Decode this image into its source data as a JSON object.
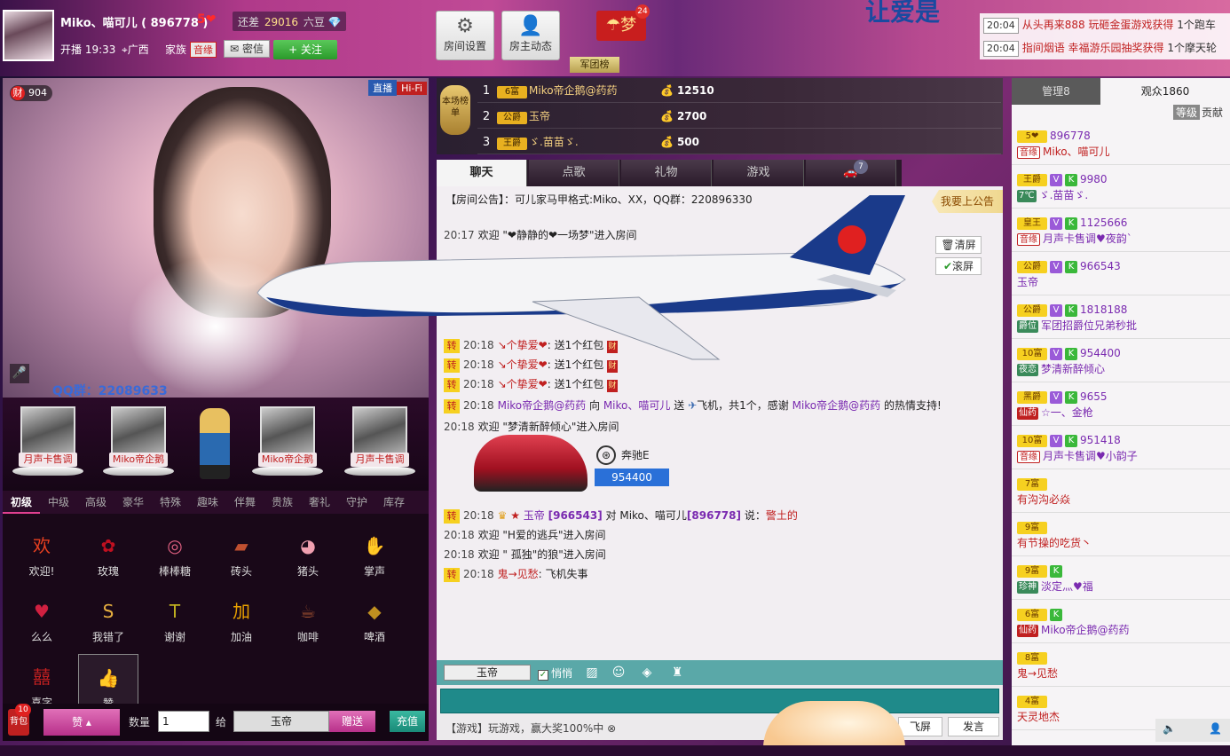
{
  "header": {
    "anchor_name": "Miko、喵可儿 ( 896778 )",
    "anchor_level": "5",
    "level_gap_label": "还差",
    "level_gap_value": "29016",
    "level_gap_unit": "六豆",
    "live_label": "开播",
    "live_time": "19:33",
    "location": "广西",
    "family_label": "家族",
    "family_badge": "音缘",
    "message_label": "密信",
    "follow_label": "+ 关注",
    "tool_settings": "房间设置",
    "tool_owner": "房主动态",
    "dream_label": "梦",
    "dream_count": "24",
    "army_label": "军团榜",
    "banner_text": "让爱是"
  },
  "ticker": [
    {
      "time": "20:04",
      "text": "从头再来888 玩砸金蛋游戏获得",
      "tail": "1个跑车"
    },
    {
      "time": "20:04",
      "text": "指间烟语 幸福游乐园抽奖获得",
      "tail": "1个摩天轮"
    }
  ],
  "video": {
    "money_icon": "财",
    "money_value": "904",
    "tag_live": "直播",
    "tag_hifi": "Hi-Fi",
    "qq_overlay": "QQ群：22089633"
  },
  "mic_seats": [
    "月声卡售调",
    "Miko帝企鹅",
    "Miko帝企鹅",
    "月声卡售调"
  ],
  "gift_tabs": [
    "初级",
    "中级",
    "高级",
    "豪华",
    "特殊",
    "趣味",
    "伴舞",
    "贵族",
    "奢礼",
    "守护",
    "库存"
  ],
  "gifts": [
    {
      "name": "欢迎!",
      "icon": "欢",
      "color": "#e84020"
    },
    {
      "name": "玫瑰",
      "icon": "✿",
      "color": "#c01020"
    },
    {
      "name": "棒棒糖",
      "icon": "◎",
      "color": "#e06080"
    },
    {
      "name": "砖头",
      "icon": "▰",
      "color": "#c05030"
    },
    {
      "name": "猪头",
      "icon": "◕",
      "color": "#f0a0b0"
    },
    {
      "name": "掌声",
      "icon": "✋",
      "color": "#e8a020"
    },
    {
      "name": "么么",
      "icon": "♥",
      "color": "#d02040"
    },
    {
      "name": "我错了",
      "icon": "S",
      "color": "#e8b040"
    },
    {
      "name": "谢谢",
      "icon": "T",
      "color": "#c0b020"
    },
    {
      "name": "加油",
      "icon": "加",
      "color": "#e8a000"
    },
    {
      "name": "咖啡",
      "icon": "☕",
      "color": "#a05030"
    },
    {
      "name": "啤酒",
      "icon": "◆",
      "color": "#c09020"
    },
    {
      "name": "喜字",
      "icon": "囍",
      "color": "#c02020"
    },
    {
      "name": "赞",
      "icon": "👍",
      "color": "#e0a030"
    }
  ],
  "send_bar": {
    "bag_label": "背包",
    "bag_count": "10",
    "gift_pick": "赞",
    "qty_label": "数量",
    "qty_value": "1",
    "give_label": "给",
    "target": "玉帝",
    "send_label": "赠送",
    "recharge": "充值"
  },
  "rank": {
    "stamp": "本场榜单",
    "rows": [
      {
        "rank": "1",
        "badge": "6富",
        "name": "Miko帝企鹅@药药",
        "value": "12510"
      },
      {
        "rank": "2",
        "badge": "公爵",
        "name": "玉帝",
        "value": "2700"
      },
      {
        "rank": "3",
        "badge": "王爵",
        "name": "ゞ.苗苗ゞ.",
        "value": "500"
      }
    ]
  },
  "chat_tabs": [
    "聊天",
    "点歌",
    "礼物",
    "游戏",
    ""
  ],
  "chat_tab_badge": "7",
  "chat": {
    "announce": "【房间公告】：可儿家马甲格式:Miko、XX，QQ群：220896330",
    "post_announce": "我要上公告",
    "clear": "清屏",
    "scroll": "滚屏",
    "msgs": [
      {
        "time": "20:17",
        "text": "欢迎 \"❤静静的❤一场梦\"进入房间"
      },
      {
        "time": "20:18",
        "user": "↘个挚爱❤",
        "text": ": 送1个红包"
      },
      {
        "time": "20:18",
        "user": "↘个挚爱❤",
        "text": ": 送1个红包"
      },
      {
        "time": "20:18",
        "user": "↘个挚爱❤",
        "text": ": 送1个红包"
      },
      {
        "time": "20:18",
        "user": "Miko帝企鹅@药药",
        "text": "向",
        "target": "Miko、喵可儿",
        "text2": "送",
        "text3": "飞机，共1个，感谢",
        "user2": "Miko帝企鹅@药药",
        "text4": "的热情支持!"
      },
      {
        "time": "20:18",
        "text": "欢迎 \"梦清新醉倾心\"进入房间"
      },
      {
        "time": "20:18",
        "user": "玉帝",
        "uid": "[966543]",
        "text": "对 Miko、喵可儿",
        "uid2": "[896778]",
        "text2": "说：",
        "content": "警土的"
      },
      {
        "time": "20:18",
        "text": "欢迎 \"H爱的逃兵\"进入房间"
      },
      {
        "time": "20:18",
        "text": "欢迎 \" 孤独\"的狼\"进入房间"
      },
      {
        "time": "20:18",
        "user": "鬼→见愁",
        "text": ": 飞机失事"
      }
    ],
    "car_name": "奔驰E",
    "car_id": "954400",
    "zhuan": "转",
    "redpack": "财"
  },
  "chat_toolbar": {
    "target": "玉帝",
    "whisper": "悄悄",
    "input_placeholder": "",
    "game_tip": "【游戏】玩游戏，赢大奖100%中",
    "fly": "飞屏",
    "speak": "发言"
  },
  "audience": {
    "tab_admin": "管理8",
    "tab_audience": "观众1860",
    "sub_level": "等级",
    "sub_contrib": "贡献",
    "rows": [
      {
        "rich": "5❤",
        "v": false,
        "k": false,
        "uid": "896778",
        "fam": "音缘",
        "name": "Miko、喵可儿",
        "red": true
      },
      {
        "rich": "王爵",
        "v": true,
        "k": true,
        "uid": "9980",
        "fam": "7℃",
        "name": "ゞ.苗苗ゞ.",
        "red": false
      },
      {
        "rich": "皇王",
        "v": true,
        "k": true,
        "uid": "1125666",
        "fam": "音缘",
        "name": "月声卡售调♥夜韵`",
        "red": false
      },
      {
        "rich": "公爵",
        "v": true,
        "k": true,
        "uid": "966543",
        "fam": "",
        "name": "玉帝",
        "red": false
      },
      {
        "rich": "公爵",
        "v": true,
        "k": true,
        "uid": "1818188",
        "fam": "爵位",
        "name": "军团招爵位兄弟秒批",
        "red": false
      },
      {
        "rich": "10富",
        "v": true,
        "k": true,
        "uid": "954400",
        "fam": "夜恋",
        "name": "梦清新醉倾心",
        "red": false
      },
      {
        "rich": "黑爵",
        "v": true,
        "k": true,
        "uid": "9655",
        "fam": "仙药",
        "name": "☆一、金枪",
        "red": false
      },
      {
        "rich": "10富",
        "v": true,
        "k": true,
        "uid": "951418",
        "fam": "音缘",
        "name": "月声卡售调♥小韵子",
        "red": false
      },
      {
        "rich": "7富",
        "v": false,
        "k": false,
        "uid": "",
        "fam": "",
        "name": "有沟沟必焱",
        "red": true
      },
      {
        "rich": "9富",
        "v": false,
        "k": false,
        "uid": "",
        "fam": "",
        "name": "有节操的吃货丶",
        "red": true
      },
      {
        "rich": "9富",
        "v": false,
        "k": true,
        "uid": "",
        "fam": "珍神",
        "name": "淡定灬♥福",
        "red": false
      },
      {
        "rich": "6富",
        "v": false,
        "k": true,
        "uid": "",
        "fam": "仙药",
        "name": "Miko帝企鹅@药药",
        "red": false
      },
      {
        "rich": "8富",
        "v": false,
        "k": false,
        "uid": "",
        "fam": "",
        "name": "鬼→见愁",
        "red": true
      },
      {
        "rich": "4富",
        "v": false,
        "k": false,
        "uid": "",
        "fam": "",
        "name": "天灵地杰",
        "red": true
      }
    ]
  }
}
